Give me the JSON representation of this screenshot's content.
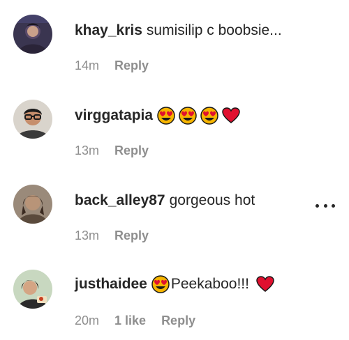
{
  "comments": [
    {
      "username": "khay_kris",
      "text": "sumisilip c boobsie...",
      "time": "14m",
      "likes": "",
      "reply": "Reply",
      "avatar": "avatar-dark-purple"
    },
    {
      "username": "virggatapia",
      "text": "",
      "emojis": [
        "heart-eyes-emoji",
        "heart-eyes-emoji",
        "heart-eyes-emoji",
        "red-heart-emoji"
      ],
      "time": "13m",
      "likes": "",
      "reply": "Reply",
      "avatar": "avatar-glasses-man"
    },
    {
      "username": "back_alley87",
      "text": "gorgeous hot",
      "time": "13m",
      "likes": "",
      "reply": "Reply",
      "avatar": "avatar-dark-hair",
      "more_icon": "more-options-icon"
    },
    {
      "username": "justhaidee",
      "text": "Peekaboo!!!",
      "emojis_before": [
        "heart-eyes-emoji"
      ],
      "emojis_after": [
        "red-heart-emoji"
      ],
      "time": "20m",
      "likes": "1 like",
      "reply": "Reply",
      "avatar": "avatar-woman-smiling"
    }
  ],
  "colors": {
    "text": "#262626",
    "meta": "#8e8e8e",
    "emoji_face": "#f7b500",
    "heart": "#e0102f"
  }
}
